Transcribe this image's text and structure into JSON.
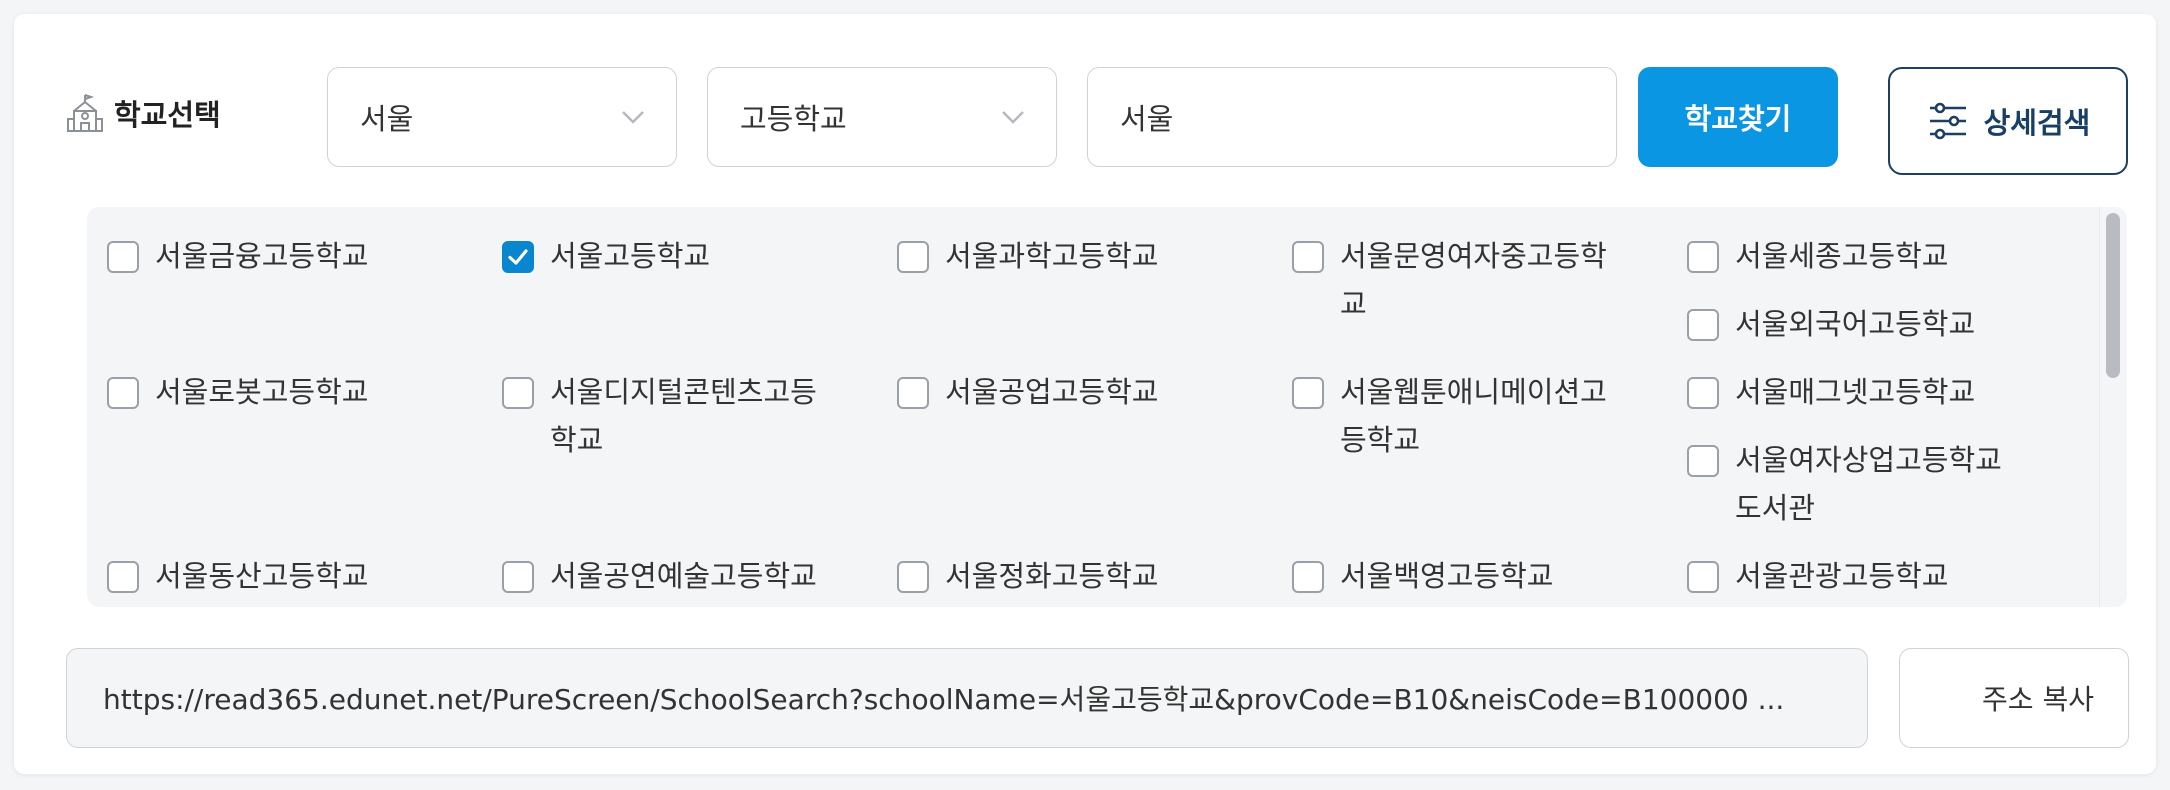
{
  "label": {
    "text": "학교선택"
  },
  "filters": {
    "region": "서울",
    "level": "고등학교",
    "query": "서울"
  },
  "buttons": {
    "search": "학교찾기",
    "detail": "상세검색",
    "copy": "주소 복사"
  },
  "schools": [
    {
      "name": "서울금융고등학교",
      "checked": false
    },
    {
      "name": "서울고등학교",
      "checked": true
    },
    {
      "name": "서울과학고등학교",
      "checked": false
    },
    {
      "name": "서울문영여자중고등학교",
      "checked": false
    },
    {
      "name": "서울세종고등학교",
      "checked": false
    },
    {
      "name": "서울외국어고등학교",
      "checked": false
    },
    {
      "name": "서울로봇고등학교",
      "checked": false
    },
    {
      "name": "서울디지털콘텐츠고등학교",
      "checked": false
    },
    {
      "name": "서울공업고등학교",
      "checked": false
    },
    {
      "name": "서울웹툰애니메이션고등학교",
      "checked": false
    },
    {
      "name": "서울매그넷고등학교",
      "checked": false
    },
    {
      "name": "서울여자상업고등학교도서관",
      "checked": false
    },
    {
      "name": "서울동산고등학교",
      "checked": false
    },
    {
      "name": "서울공연예술고등학교",
      "checked": false
    },
    {
      "name": "서울정화고등학교",
      "checked": false
    },
    {
      "name": "서울백영고등학교",
      "checked": false
    },
    {
      "name": "서울관광고등학교",
      "checked": false
    }
  ],
  "url": {
    "value": "https://read365.edunet.net/PureScreen/SchoolSearch?schoolName=서울고등학교&provCode=B10&neisCode=B100000 ..."
  },
  "icons": {
    "label": "school-building-icon",
    "detail": "sliders-icon",
    "dropdown": "chevron-down-icon",
    "check": "check-icon"
  },
  "colors": {
    "primary": "#0a96e2",
    "checkbox_checked": "#0a86d0",
    "detail_border": "#1d3f63",
    "panel_bg": "#f4f5f7"
  }
}
